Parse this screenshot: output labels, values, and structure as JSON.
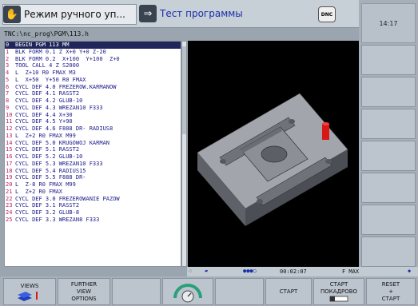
{
  "header": {
    "mode_manual": "Режим ручного уп...",
    "mode_test": "Тест программы",
    "dnc_label": "DNC"
  },
  "clock": {
    "time": "14:17"
  },
  "program": {
    "path": "TNC:\\nc_prog\\PGM\\113.h",
    "lines": [
      {
        "n": "0",
        "t": "BEGIN PGM 113 MM"
      },
      {
        "n": "1",
        "t": "BLK FORM 0.1 Z X+0 Y+0 Z-20"
      },
      {
        "n": "2",
        "t": "BLK FORM 0.2  X+100  Y+100  Z+0"
      },
      {
        "n": "3",
        "t": "TOOL CALL 4 Z S2000"
      },
      {
        "n": "4",
        "t": "L  Z+10 R0 FMAX M3"
      },
      {
        "n": "5",
        "t": "L  X+50  Y+50 R0 FMAX"
      },
      {
        "n": "6",
        "t": "CYCL DEF 4.0 FREZEROW.KARMANOW"
      },
      {
        "n": "7",
        "t": "CYCL DEF 4.1 RASST2"
      },
      {
        "n": "8",
        "t": "CYCL DEF 4.2 GLUB-10"
      },
      {
        "n": "9",
        "t": "CYCL DEF 4.3 WREZAN10 F333"
      },
      {
        "n": "10",
        "t": "CYCL DEF 4.4 X+30"
      },
      {
        "n": "11",
        "t": "CYCL DEF 4.5 Y+90"
      },
      {
        "n": "12",
        "t": "CYCL DEF 4.6 F888 DR- RADIUS8"
      },
      {
        "n": "13",
        "t": "L  Z+2 R0 FMAX M99"
      },
      {
        "n": "14",
        "t": "CYCL DEF 5.0 KRUGOWOJ KARMAN"
      },
      {
        "n": "15",
        "t": "CYCL DEF 5.1 RASST2"
      },
      {
        "n": "16",
        "t": "CYCL DEF 5.2 GLUB-10"
      },
      {
        "n": "17",
        "t": "CYCL DEF 5.3 WREZAN10 F333"
      },
      {
        "n": "18",
        "t": "CYCL DEF 5.4 RADIUS15"
      },
      {
        "n": "19",
        "t": "CYCL DEF 5.5 F888 DR-"
      },
      {
        "n": "20",
        "t": "L  Z-8 R0 FMAX M99"
      },
      {
        "n": "21",
        "t": "L  Z+2 R0 FMAX"
      },
      {
        "n": "22",
        "t": "CYCL DEF 3.0 FREZEROWANIE PAZOW"
      },
      {
        "n": "23",
        "t": "CYCL DEF 3.1 RASST2"
      },
      {
        "n": "24",
        "t": "CYCL DEF 3.2 GLUB-8"
      },
      {
        "n": "25",
        "t": "CYCL DEF 3.3 WREZAN8 F333"
      }
    ]
  },
  "status": {
    "time": "00:02:07",
    "feed": "F MAX"
  },
  "softkeys": {
    "views": "VIEWS",
    "further_1": "FURTHER",
    "further_2": "VIEW",
    "further_3": "OPTIONS",
    "start": "СТАРТ",
    "start_single_1": "СТАРТ",
    "start_single_2": "ПОКАДРОВО",
    "reset_1": "RESET",
    "reset_2": "+",
    "reset_3": "СТАРТ"
  },
  "colors": {
    "selected_row_bg": "#20265a",
    "line_number": "#c0206a",
    "code_text": "#1a1a8a",
    "tool": "#d81818"
  }
}
